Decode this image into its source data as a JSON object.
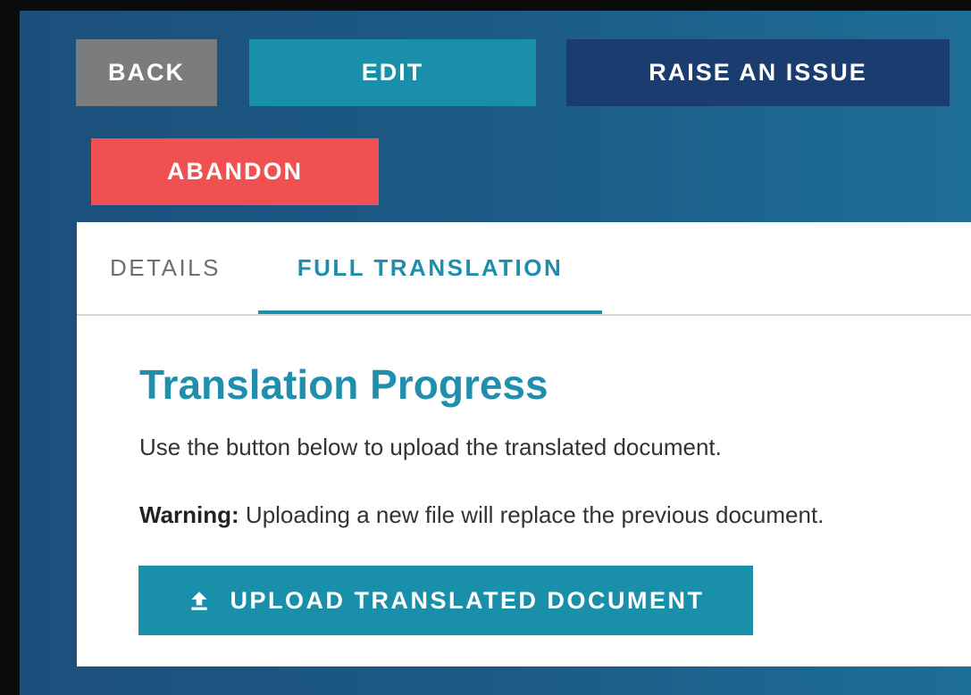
{
  "toolbar": {
    "back_label": "BACK",
    "edit_label": "EDIT",
    "raise_issue_label": "RAISE AN ISSUE",
    "abandon_label": "ABANDON"
  },
  "tabs": [
    {
      "label": "DETAILS",
      "active": false
    },
    {
      "label": "FULL TRANSLATION",
      "active": true
    }
  ],
  "content": {
    "title": "Translation Progress",
    "description": "Use the button below to upload the translated document.",
    "warning_label": "Warning:",
    "warning_text": " Uploading a new file will replace the previous document.",
    "upload_button": {
      "label": "UPLOAD TRANSLATED DOCUMENT",
      "icon": "upload-icon"
    }
  },
  "colors": {
    "accent": "#1a8faa",
    "back_button": "#7b7c7e",
    "raise_issue_button": "#1b3c6e",
    "abandon_button": "#f05050",
    "background": "#1c5c86"
  }
}
